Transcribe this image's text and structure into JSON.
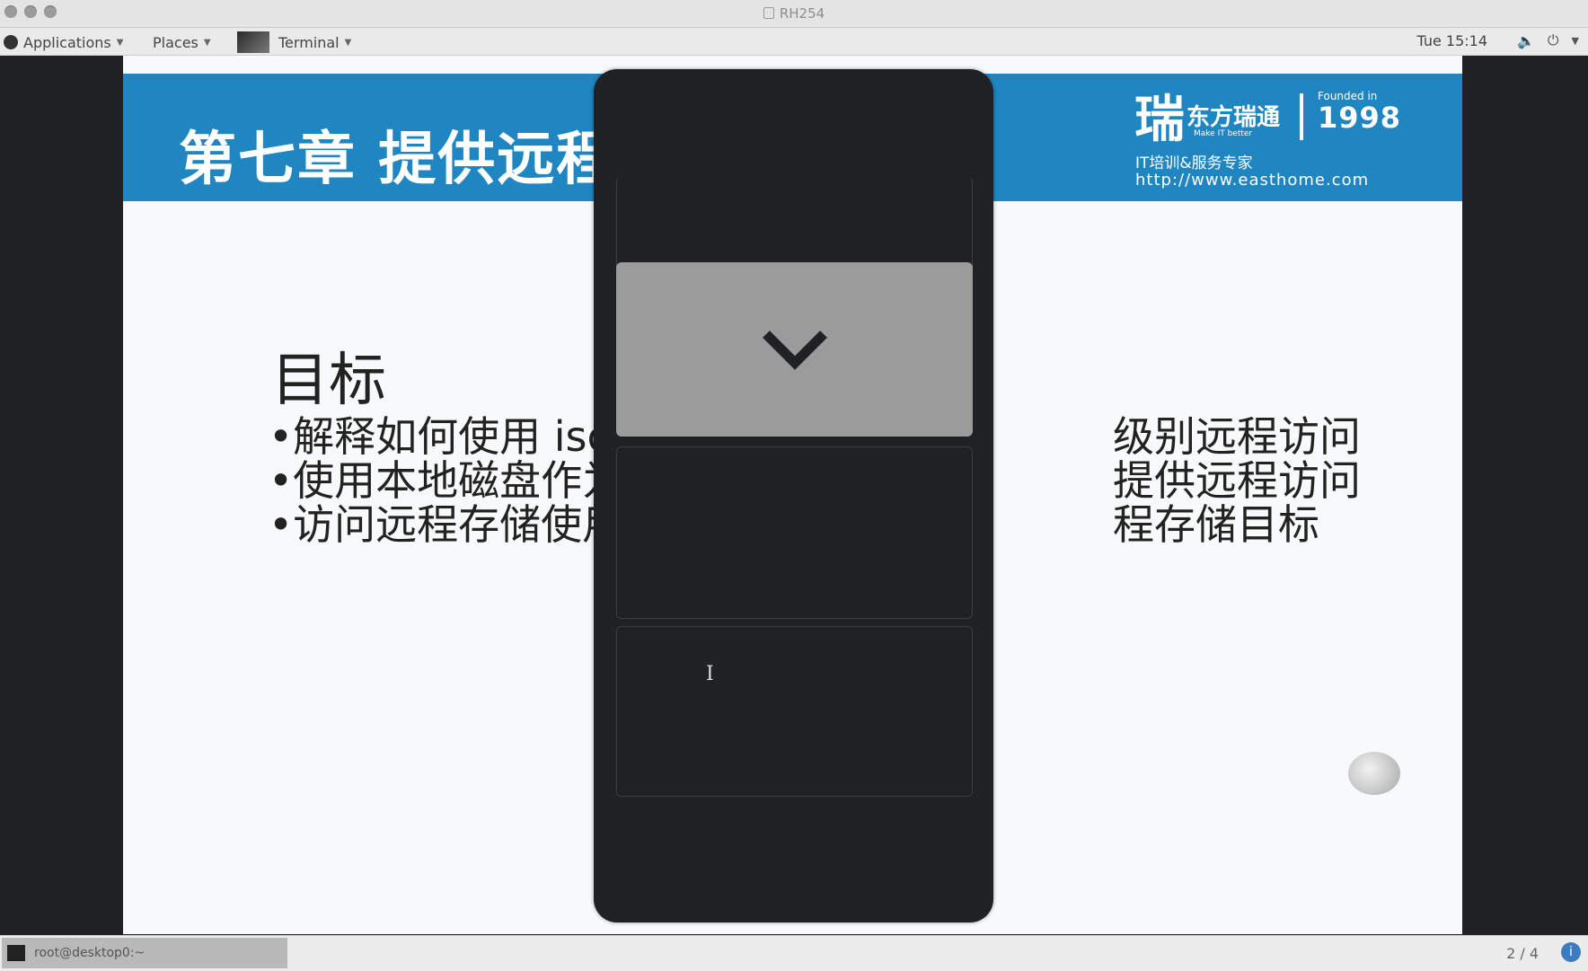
{
  "window": {
    "title": "RH254"
  },
  "topbar": {
    "applications": "Applications",
    "places": "Places",
    "terminal": "Terminal",
    "clock": "Tue 15:14"
  },
  "slide": {
    "chapter_title": "第七章 提供远程",
    "logo_name": "东方瑞通",
    "logo_tagline": "Make IT better",
    "founded_label": "Founded in",
    "founded_year": "1998",
    "slogan": "IT培训&服务专家",
    "url": "http://www.easthome.com",
    "goal_heading": "目标",
    "bullets_left": [
      "•解释如何使用 iscs",
      "•使用本地磁盘作为",
      "•访问远程存储使用"
    ],
    "bullets_right": [
      "级别远程访问",
      "提供远程访问",
      "程存储目标"
    ]
  },
  "overlay": {
    "selected_slot_icon": "chevron-down-icon"
  },
  "taskbar": {
    "task_label": "root@desktop0:~",
    "pager": "2 / 4"
  },
  "colors": {
    "banner": "#1f86c2",
    "overlay": "#1f2125",
    "selected_slot": "#9b9b9b"
  }
}
